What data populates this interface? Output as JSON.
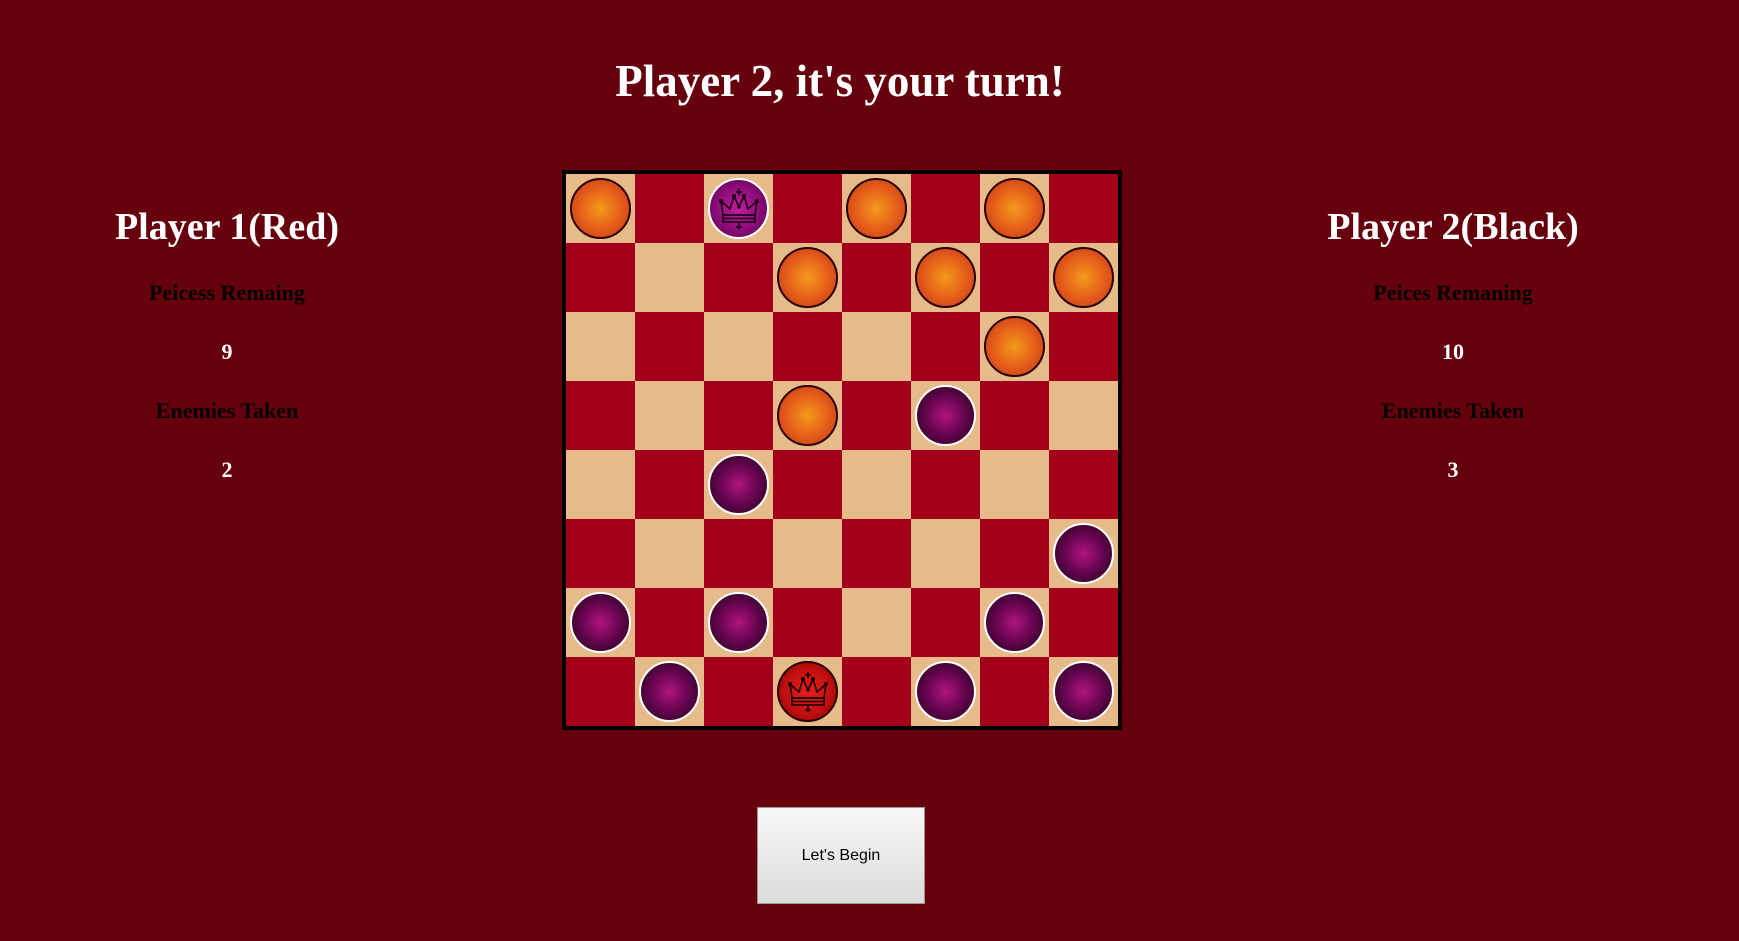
{
  "turn_message": "Player 2, it's your turn!",
  "player1": {
    "name": "Player 1(Red)",
    "pieces_label": "Peicess Remaing",
    "pieces_value": "9",
    "taken_label": "Enemies Taken",
    "taken_value": "2"
  },
  "player2": {
    "name": "Player 2(Black)",
    "pieces_label": "Peices Remaning",
    "pieces_value": "10",
    "taken_label": "Enemies Taken",
    "taken_value": "3"
  },
  "board": {
    "rows": [
      [
        "r",
        "",
        "BK",
        "",
        "r",
        "",
        "r",
        ""
      ],
      [
        "",
        "",
        "",
        "r",
        "",
        "r",
        "",
        "r"
      ],
      [
        "",
        "",
        "",
        "",
        "",
        "",
        "r",
        ""
      ],
      [
        "",
        "",
        "",
        "r",
        "",
        "b",
        "",
        ""
      ],
      [
        "",
        "",
        "b",
        "",
        "",
        "",
        "",
        ""
      ],
      [
        "",
        "",
        "",
        "",
        "",
        "",
        "",
        "b"
      ],
      [
        "b",
        "",
        "b",
        "",
        "",
        "",
        "b",
        ""
      ],
      [
        "",
        "b",
        "",
        "RK",
        "",
        "b",
        "",
        "b"
      ]
    ],
    "colors": {
      "light_square": "#e6bb89",
      "dark_square": "#a3001b",
      "background": "#66000c"
    }
  },
  "begin_button": {
    "label": "Let's Begin"
  }
}
